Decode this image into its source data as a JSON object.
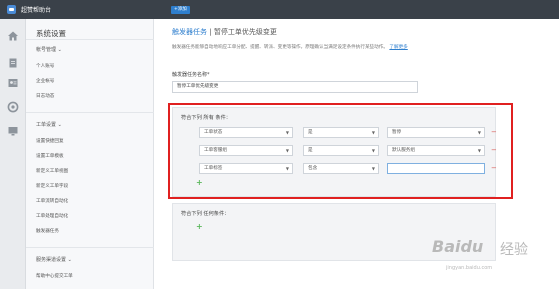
{
  "app": {
    "title": "超赞帮助台"
  },
  "topbar": {
    "add_label": "+添加"
  },
  "rail": {
    "icons": [
      "home-icon",
      "document-icon",
      "contact-card-icon",
      "settings-gear-icon",
      "monitor-icon"
    ]
  },
  "sidebar": {
    "title": "系统设置",
    "groups": [
      {
        "label": "帐号管理 ⌄",
        "items": [
          "个人账号",
          "企业帐号",
          "日志动态"
        ]
      },
      {
        "label": "工单设置 ⌄",
        "items": [
          "设置快捷回复",
          "设置工单模板",
          "新定义工单视图",
          "新定义工单字段",
          "工单流转自动化",
          "工单处理自动化",
          "触发器任务"
        ]
      },
      {
        "label": "服务渠道设置 ⌄",
        "items": [
          "帮助中心提交工单"
        ]
      }
    ]
  },
  "breadcrumb": {
    "link": "触发器任务",
    "separator": "|",
    "current": "暂停工单优先级变更"
  },
  "description": {
    "text": "触发器任务能够自动地响应工单分配、提醒、转派、变更等操作，原理确认当满足设定条件执行某些动作。",
    "more_link": "了解更多"
  },
  "form": {
    "name_label": "触发器任务名称*",
    "name_value": "暂停工单优先级变更"
  },
  "all_conditions": {
    "title": "符合下列 所有 条件：",
    "rows": [
      {
        "field": "工单状态",
        "operator": "是",
        "value": "暂停",
        "value_is_select": true
      },
      {
        "field": "工单客服组",
        "operator": "是",
        "value": "默认服务组",
        "value_is_select": true
      },
      {
        "field": "工单标签",
        "operator": "包含",
        "value": "",
        "value_is_select": false
      }
    ],
    "add_label": "+"
  },
  "any_conditions": {
    "title": "符合下列 任何条件：",
    "add_label": "+"
  },
  "watermark": {
    "brand": "Baidu",
    "cn": "经验",
    "url": "jingyan.baidu.com"
  },
  "colors": {
    "topbar": "#3a4149",
    "accent": "#2f7fce",
    "highlight": "#e02020",
    "remove": "#d9534f",
    "add": "#5cb85c"
  }
}
